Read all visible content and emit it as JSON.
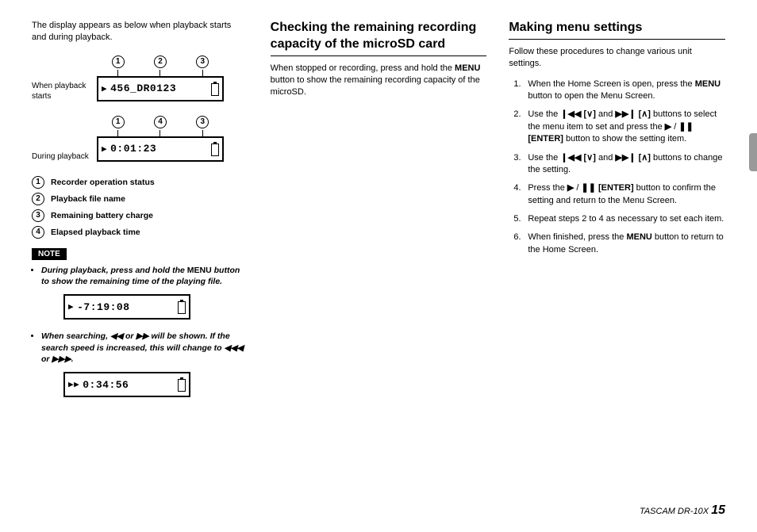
{
  "col1": {
    "intro": "The display appears as below when playback starts and during playback.",
    "label_playback_starts": "When playback starts",
    "label_during_playback": "During playback",
    "callout_1": "1",
    "callout_2": "2",
    "callout_3": "3",
    "callout_4": "4",
    "lcd1_text": "456_DR0123",
    "lcd2_text": "0:01:23",
    "legend": {
      "l1": "Recorder operation status",
      "l2": "Playback file name",
      "l3": "Remaining battery charge",
      "l4": "Elapsed playback time"
    },
    "note_label": "NOTE",
    "note1_a": "During playback, press and hold the ",
    "note1_b": "MENU",
    "note1_c": " button to show the remaining time of the playing file.",
    "lcd3_text": "-7:19:08",
    "note2_a": "When searching, ",
    "note2_b": " or ",
    "note2_c": " will be shown. If the search speed is increased, this will change to ",
    "note2_d": " or ",
    "note2_e": ".",
    "lcd4_text": "0:34:56"
  },
  "col2": {
    "heading": "Checking the remaining recording capacity of the microSD card",
    "body_a": "When stopped or recording, press and hold the ",
    "body_b": "MENU",
    "body_c": " button to show the remaining recording capacity of the microSD."
  },
  "col3": {
    "heading": "Making menu settings",
    "intro": "Follow these procedures to change various unit settings.",
    "steps": {
      "s1_a": "When the Home Screen is open, press the ",
      "s1_b": "MENU",
      "s1_c": " button to open the Menu Screen.",
      "s2_a": "Use the ",
      "s2_b": " and ",
      "s2_c": " buttons to select the menu item to set and press the ",
      "s2_d": "[ENTER]",
      "s2_e": " button to show the setting item.",
      "s3_a": "Use the ",
      "s3_b": " and ",
      "s3_c": " buttons to change the setting.",
      "s4_a": "Press the ",
      "s4_b": "[ENTER]",
      "s4_c": " button to confirm the setting and return to the Menu Screen.",
      "s5": "Repeat steps 2 to 4 as necessary to set each item.",
      "s6_a": "When finished, press the ",
      "s6_b": "MENU",
      "s6_c": " button to return to the Home Screen."
    }
  },
  "footer": {
    "product": "TASCAM  DR-10X ",
    "page": "15"
  },
  "symbols": {
    "play": "▶",
    "pause": "❚❚",
    "rew": "◀◀",
    "fwd": "▶▶",
    "prev": "❙◀◀",
    "next": "▶▶❙",
    "down": "[∨]",
    "up": "[∧]",
    "trew": "◀◀◀",
    "tfwd": "▶▶▶"
  }
}
